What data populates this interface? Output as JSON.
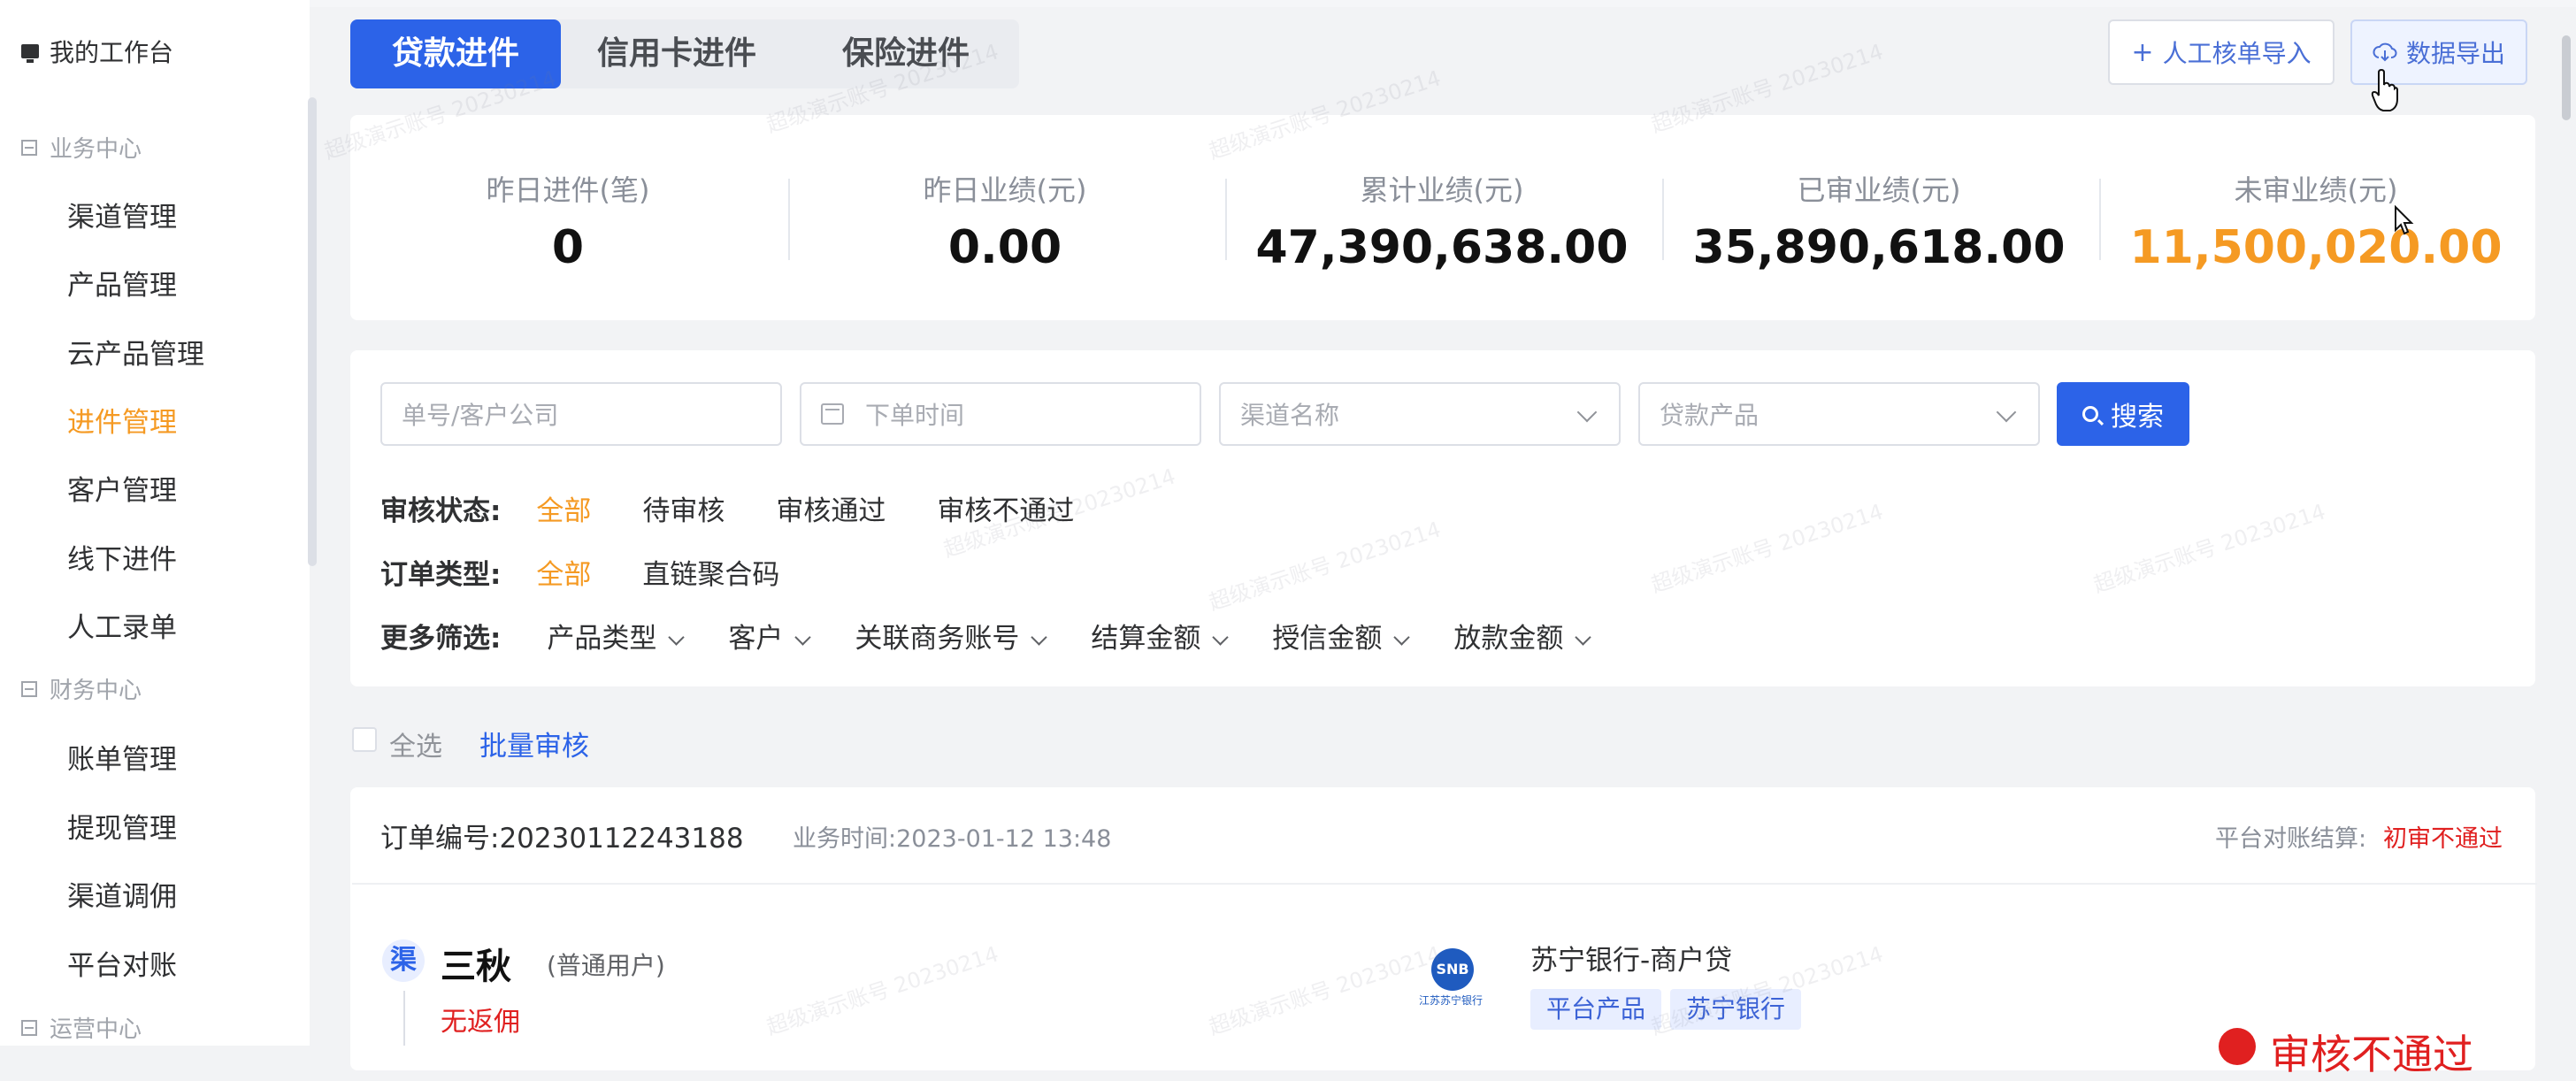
{
  "sidebar": {
    "workspace": "我的工作台",
    "sections": [
      {
        "label": "业务中心",
        "items": [
          "渠道管理",
          "产品管理",
          "云产品管理",
          "进件管理",
          "客户管理",
          "线下进件",
          "人工录单"
        ]
      },
      {
        "label": "财务中心",
        "items": [
          "账单管理",
          "提现管理",
          "渠道调佣",
          "平台对账"
        ]
      },
      {
        "label": "运营中心",
        "items": []
      }
    ],
    "active_item": "进件管理"
  },
  "tabs": [
    "贷款进件",
    "信用卡进件",
    "保险进件"
  ],
  "active_tab": "贷款进件",
  "toolbar": {
    "import_label": "人工核单导入",
    "export_label": "数据导出"
  },
  "stats": [
    {
      "label": "昨日进件(笔)",
      "value": "0"
    },
    {
      "label": "昨日业绩(元)",
      "value": "0.00"
    },
    {
      "label": "累计业绩(元)",
      "value": "47,390,638.00"
    },
    {
      "label": "已审业绩(元)",
      "value": "35,890,618.00"
    },
    {
      "label": "未审业绩(元)",
      "value": "11,500,020.00"
    }
  ],
  "filters": {
    "order_placeholder": "单号/客户公司",
    "time_placeholder": "下单时间",
    "channel_placeholder": "渠道名称",
    "product_placeholder": "贷款产品",
    "search_label": "搜索",
    "audit": {
      "label": "审核状态:",
      "options": [
        "全部",
        "待审核",
        "审核通过",
        "审核不通过"
      ],
      "selected": "全部"
    },
    "order_type": {
      "label": "订单类型:",
      "options": [
        "全部",
        "直链聚合码"
      ],
      "selected": "全部"
    },
    "more": {
      "label": "更多筛选:",
      "options": [
        "产品类型",
        "客户",
        "关联商务账号",
        "结算金额",
        "授信金额",
        "放款金额"
      ]
    }
  },
  "batch": {
    "select_all": "全选",
    "batch_review": "批量审核"
  },
  "order": {
    "number_label": "订单编号:",
    "number": "20230112243188",
    "time_label": "业务时间:",
    "time": "2023-01-12 13:48",
    "platform_label": "平台对账结算:",
    "platform_status": "初审不通过",
    "channel_badge": "渠",
    "customer_name": "三秋",
    "customer_type": "(普通用户)",
    "rebate": "无返佣",
    "bank_logo": "SNB",
    "bank_logo_sub": "江苏苏宁银行",
    "product_name": "苏宁银行-商户贷",
    "tags": [
      "平台产品",
      "苏宁银行"
    ],
    "status_partial": "审核不通过"
  },
  "watermark": "超级演示账号 20230214",
  "colors": {
    "primary": "#2c63e8",
    "accent": "#f59a23",
    "danger": "#e02020"
  }
}
